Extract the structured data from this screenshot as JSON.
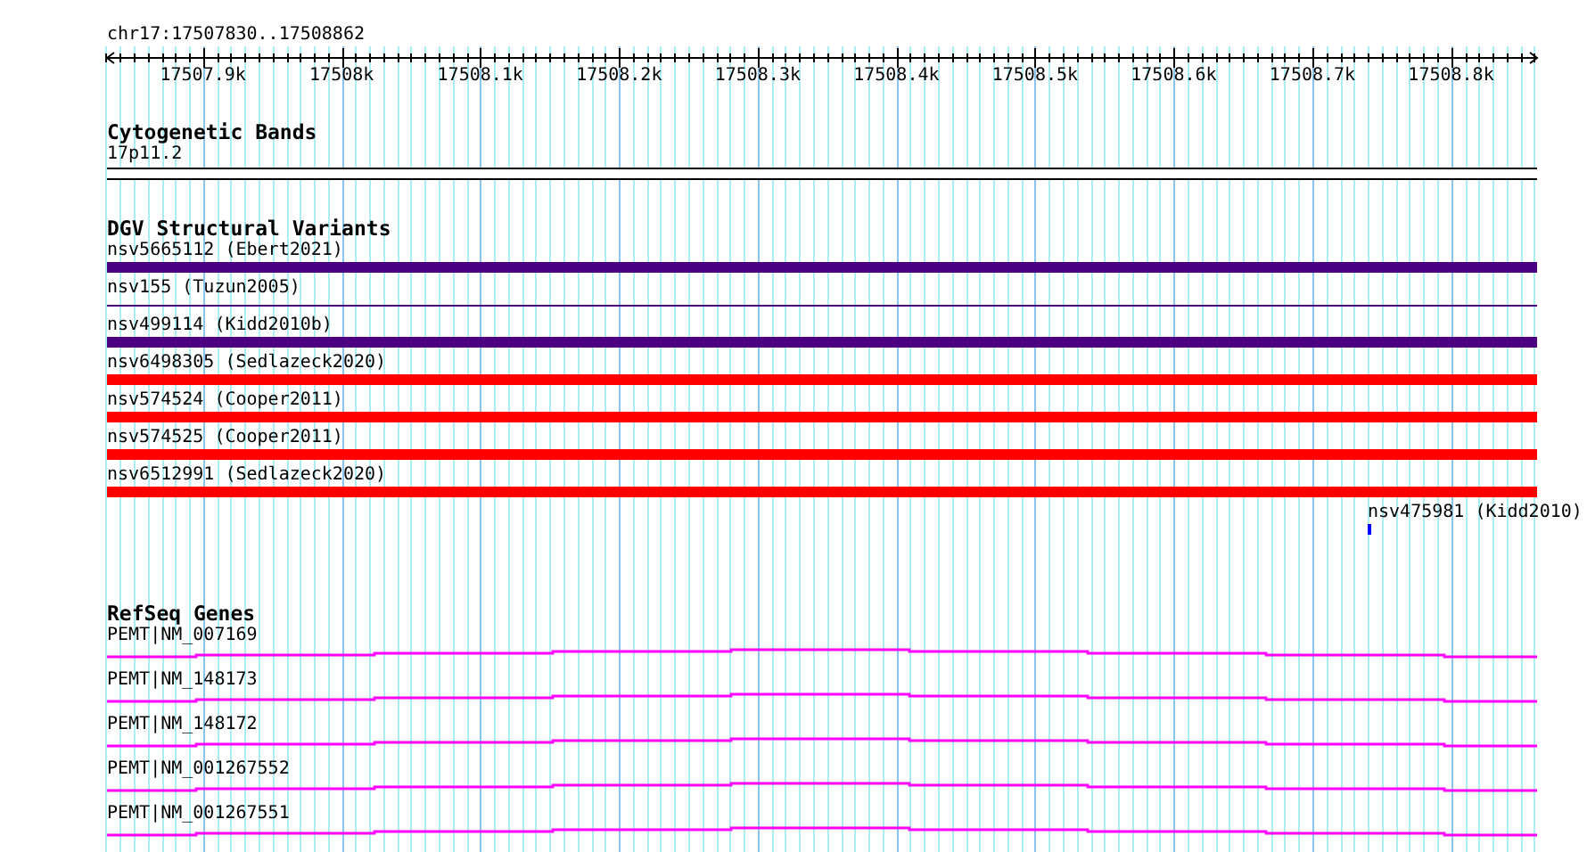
{
  "locus": "chr17:17507830..17508862",
  "ruler": {
    "ticks": [
      "17507.9k",
      "17508k",
      "17508.1k",
      "17508.2k",
      "17508.3k",
      "17508.4k",
      "17508.5k",
      "17508.6k",
      "17508.7k",
      "17508.8k"
    ]
  },
  "tracks": [
    {
      "title": "Cytogenetic Bands",
      "kind": "bands",
      "items": [
        {
          "label": "17p11.2"
        }
      ]
    },
    {
      "title": "DGV Structural Variants",
      "kind": "variants",
      "items": [
        {
          "label": "nsv5665112 (Ebert2021)",
          "kind": "thick",
          "color": "#4b0082"
        },
        {
          "label": "nsv155 (Tuzun2005)",
          "kind": "thin",
          "color": "#4b0082"
        },
        {
          "label": "nsv499114 (Kidd2010b)",
          "kind": "thick",
          "color": "#4b0082"
        },
        {
          "label": "nsv6498305 (Sedlazeck2020)",
          "kind": "thick",
          "color": "#ff0000"
        },
        {
          "label": "nsv574524 (Cooper2011)",
          "kind": "thick",
          "color": "#ff0000"
        },
        {
          "label": "nsv574525 (Cooper2011)",
          "kind": "thick",
          "color": "#ff0000"
        },
        {
          "label": "nsv6512991 (Sedlazeck2020)",
          "kind": "thick",
          "color": "#ff0000"
        },
        {
          "label": "nsv475981 (Kidd2010)",
          "kind": "point",
          "color": "#0000ff"
        }
      ]
    },
    {
      "title": "RefSeq Genes",
      "kind": "genes",
      "items": [
        {
          "label": "PEMT|NM_007169"
        },
        {
          "label": "PEMT|NM_148173"
        },
        {
          "label": "PEMT|NM_148172"
        },
        {
          "label": "PEMT|NM_001267552"
        },
        {
          "label": "PEMT|NM_001267551"
        }
      ]
    }
  ]
}
